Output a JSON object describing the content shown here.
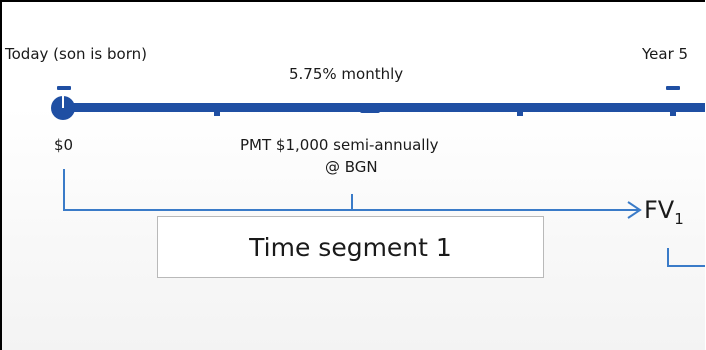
{
  "labels": {
    "start": "Today (son is born)",
    "end": "Year 5",
    "rate": "5.75% monthly",
    "amount_start": "$0",
    "payment_line1": "PMT $1,000 semi-annually",
    "payment_line2": "@ BGN"
  },
  "segment_box": {
    "text": "Time segment 1"
  },
  "future_value": {
    "symbol": "FV",
    "subscript": "1"
  },
  "colors": {
    "timeline": "#1f4fa3",
    "arrow": "#3a7bc8",
    "text": "#1a1a1a"
  }
}
